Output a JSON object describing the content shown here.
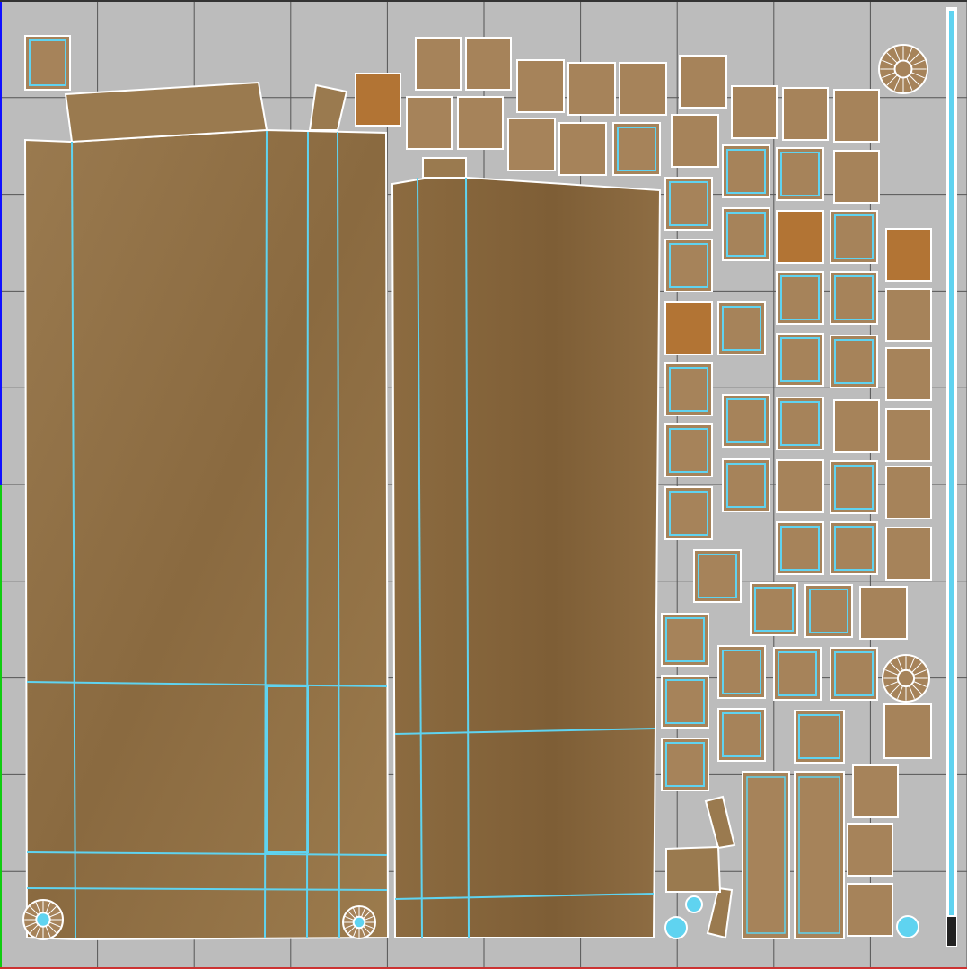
{
  "window": {
    "title": ""
  },
  "viewport": {
    "background": "#bcbcbc",
    "grid_color": "#555555",
    "island_fill": "#9a7a4f",
    "island_fill_dark": "#85643c",
    "island_fill_alt": "#b27434",
    "border_outer": "#ffffff",
    "edge_seam": "#5fd3f0",
    "axis_u_color": "#00cc00",
    "axis_v_color": "#0000ff",
    "slider_color": "#5fd3f0",
    "icons": [
      "uv-grid-icon",
      "circle-island-icon",
      "scrollbar-track"
    ]
  }
}
